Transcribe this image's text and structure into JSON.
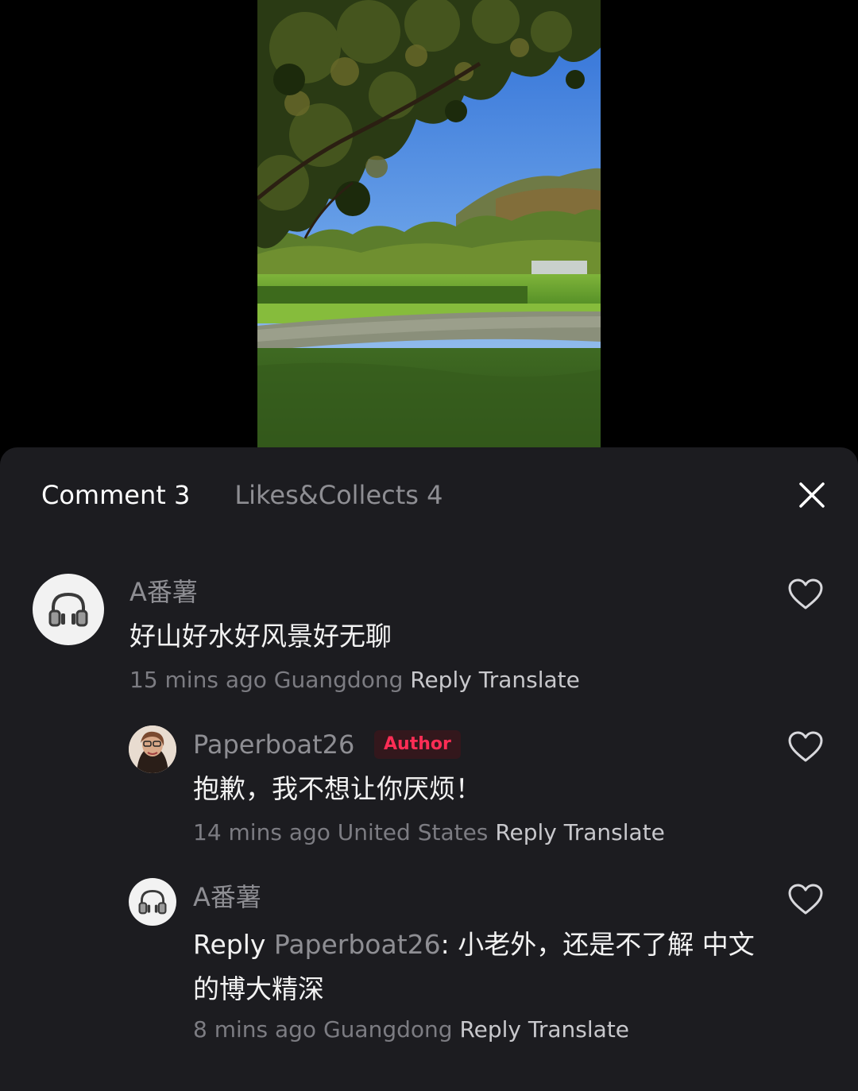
{
  "tabs": {
    "comments_label": "Comment 3",
    "likes_label": "Likes&Collects 4"
  },
  "comments": [
    {
      "username": "A番薯",
      "text": "好山好水好风景好无聊",
      "time": "15 mins ago",
      "location": "Guangdong",
      "reply_label": "Reply",
      "translate_label": "Translate"
    },
    {
      "username": "Paperboat26",
      "badge": "Author",
      "text": "抱歉，我不想让你厌烦！",
      "time": "14 mins ago",
      "location": "United States",
      "reply_label": "Reply",
      "translate_label": "Translate"
    },
    {
      "username": "A番薯",
      "reply_prefix": "Reply",
      "reply_target": "Paperboat26",
      "text": ": 小老外，还是不了解 中文的博大精深",
      "time": "8 mins ago",
      "location": "Guangdong",
      "reply_label": "Reply",
      "translate_label": "Translate"
    }
  ],
  "icons": {
    "close": "close-icon",
    "heart": "heart-icon",
    "avatar_default": "headphones-icon"
  },
  "colors": {
    "sheet_bg": "#1c1c20",
    "author_badge": "#ff2d55",
    "muted_text": "#8e8e93"
  }
}
